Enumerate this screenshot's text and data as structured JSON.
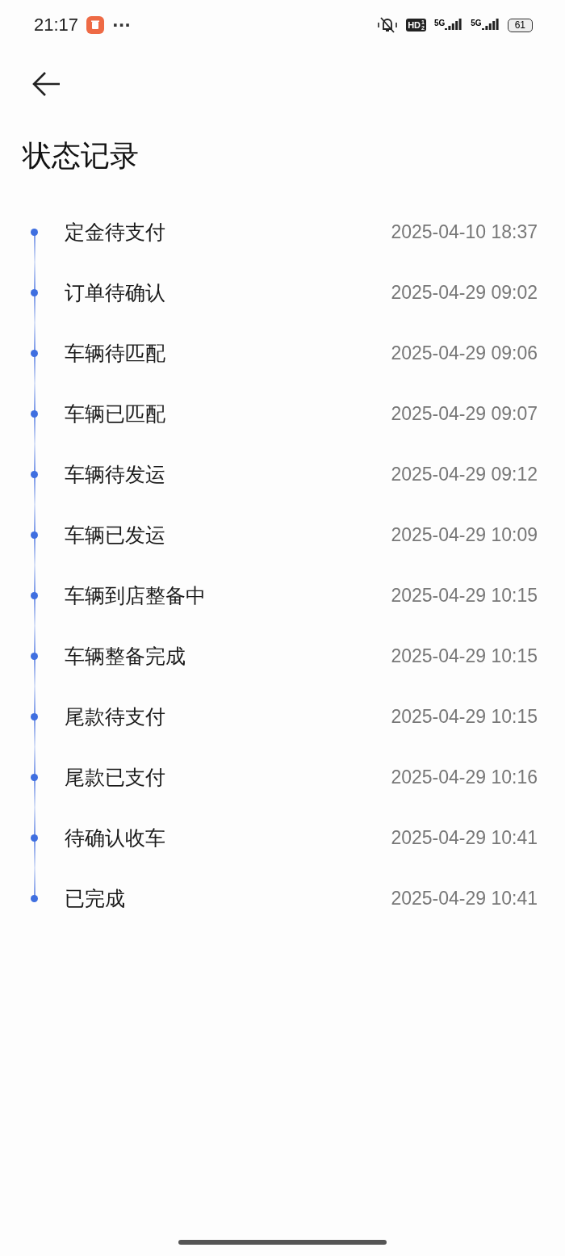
{
  "status_bar": {
    "time": "21:17",
    "more": "···",
    "hd_label": "HD",
    "hd_sub": [
      "1",
      "2"
    ],
    "networks": [
      "5G",
      "5G"
    ],
    "battery": "61"
  },
  "title": "状态记录",
  "timeline": [
    {
      "status": "定金待支付",
      "time": "2025-04-10 18:37"
    },
    {
      "status": "订单待确认",
      "time": "2025-04-29 09:02"
    },
    {
      "status": "车辆待匹配",
      "time": "2025-04-29 09:06"
    },
    {
      "status": "车辆已匹配",
      "time": "2025-04-29 09:07"
    },
    {
      "status": "车辆待发运",
      "time": "2025-04-29 09:12"
    },
    {
      "status": "车辆已发运",
      "time": "2025-04-29 10:09"
    },
    {
      "status": "车辆到店整备中",
      "time": "2025-04-29 10:15"
    },
    {
      "status": "车辆整备完成",
      "time": "2025-04-29 10:15"
    },
    {
      "status": "尾款待支付",
      "time": "2025-04-29 10:15"
    },
    {
      "status": "尾款已支付",
      "time": "2025-04-29 10:16"
    },
    {
      "status": "待确认收车",
      "time": "2025-04-29 10:41"
    },
    {
      "status": "已完成",
      "time": "2025-04-29 10:41"
    }
  ]
}
